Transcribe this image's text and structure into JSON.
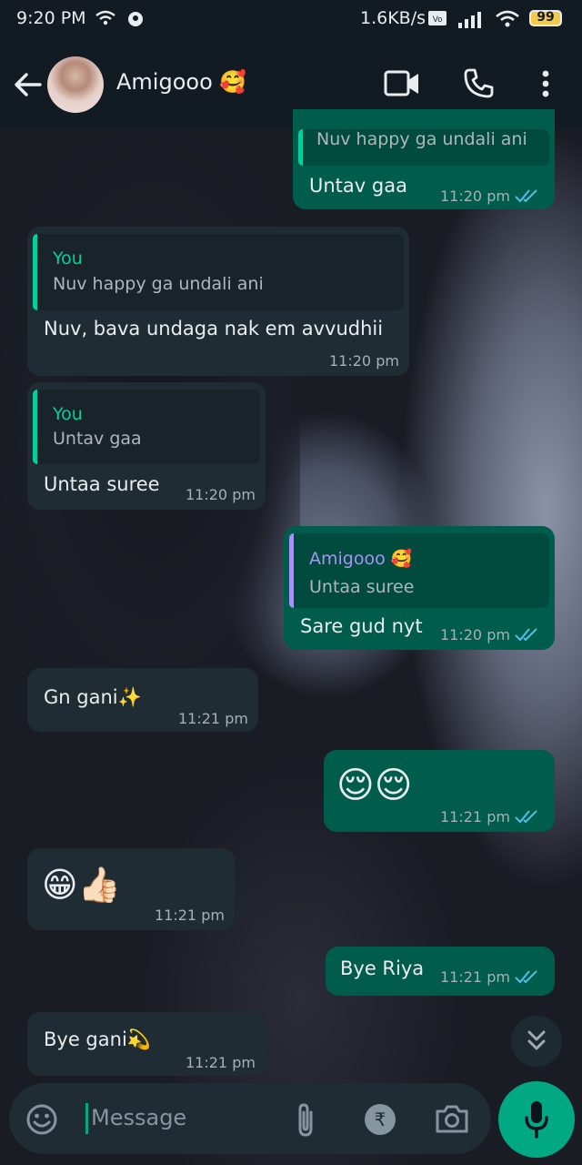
{
  "status_bar": {
    "time": "9:20 PM",
    "network_speed": "1.6KB/s",
    "battery": "99"
  },
  "header": {
    "contact_name": "Amigooo 🥰",
    "icons": [
      "back-arrow-icon",
      "video-call-icon",
      "voice-call-icon",
      "more-options-icon"
    ]
  },
  "messages": [
    {
      "id": "m1",
      "dir": "out",
      "quote": {
        "text": "Nuv happy ga undali ani"
      },
      "text": "Untav gaa",
      "time": "11:20 pm",
      "read": true
    },
    {
      "id": "m2",
      "dir": "in",
      "quote": {
        "name": "You",
        "text": "Nuv happy ga undali ani"
      },
      "text": "Nuv, bava undaga nak em avvudhii",
      "time": "11:20 pm"
    },
    {
      "id": "m3",
      "dir": "in",
      "quote": {
        "name": "You",
        "text": "Untav gaa"
      },
      "text": "Untaa suree",
      "time": "11:20 pm"
    },
    {
      "id": "m4",
      "dir": "out",
      "quote": {
        "name": "Amigooo 🥰",
        "text": "Untaa suree"
      },
      "text": "Sare gud nyt",
      "time": "11:20 pm",
      "read": true
    },
    {
      "id": "m5",
      "dir": "in",
      "text": "Gn gani✨",
      "time": "11:21 pm"
    },
    {
      "id": "m6",
      "dir": "out",
      "text": "😌😌",
      "time": "11:21 pm",
      "read": true
    },
    {
      "id": "m7",
      "dir": "in",
      "text": "😁👍🏻",
      "time": "11:21 pm"
    },
    {
      "id": "m8",
      "dir": "out",
      "text": "Bye Riya",
      "time": "11:21 pm",
      "read": true
    },
    {
      "id": "m9",
      "dir": "in",
      "text": "Bye gani💫",
      "time": "11:21 pm"
    }
  ],
  "composer": {
    "placeholder": "Message",
    "icons": [
      "emoji-icon",
      "attach-icon",
      "rupee-payment-icon",
      "camera-icon",
      "mic-icon"
    ]
  },
  "colors": {
    "incoming": "#1f2c34",
    "outgoing": "#005c4b",
    "accent": "#00a884",
    "read_tick": "#53bdeb",
    "quote_you": "#06cf9c",
    "quote_contact": "#a593f6"
  }
}
